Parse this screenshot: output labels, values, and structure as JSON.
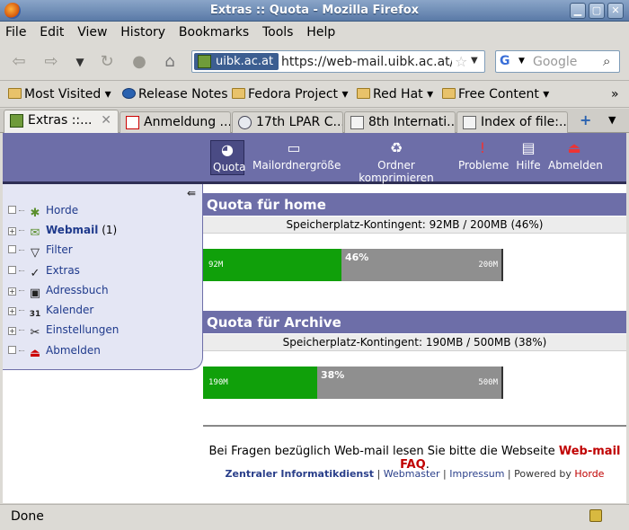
{
  "window": {
    "title": "Extras :: Quota - Mozilla Firefox"
  },
  "menu": [
    "File",
    "Edit",
    "View",
    "History",
    "Bookmarks",
    "Tools",
    "Help"
  ],
  "url": {
    "site": "uibk.ac.at",
    "address": "https://web-mail.uibk.ac.at/in"
  },
  "search": {
    "placeholder": "Google",
    "engine": "G"
  },
  "bookmarks": [
    "Most Visited",
    "Release Notes",
    "Fedora Project",
    "Red Hat",
    "Free Content"
  ],
  "tabs": [
    "Extras ::...",
    "Anmeldung ...",
    "17th LPAR C...",
    "8th Internati...",
    "Index of file:..."
  ],
  "horde_toolbar": [
    "Quota",
    "Mailordnergröße",
    "Ordner komprimieren",
    "Probleme",
    "Hilfe",
    "Abmelden"
  ],
  "sidebar": [
    {
      "label": "Horde",
      "expander": ""
    },
    {
      "label": "Webmail",
      "suffix": " (1)",
      "expander": "+"
    },
    {
      "label": "Filter",
      "expander": ""
    },
    {
      "label": "Extras",
      "expander": ""
    },
    {
      "label": "Adressbuch",
      "expander": "+"
    },
    {
      "label": "Kalender",
      "expander": "+"
    },
    {
      "label": "Einstellungen",
      "expander": "+"
    },
    {
      "label": "Abmelden",
      "expander": ""
    }
  ],
  "quotas": [
    {
      "title": "Quota für home",
      "summary": "Speicherplatz-Kontingent: 92MB / 200MB (46%)",
      "used_label": "92M",
      "max_label": "200M",
      "percent_label": "46%",
      "fraction": 0.46
    },
    {
      "title": "Quota für Archive",
      "summary": "Speicherplatz-Kontingent: 190MB / 500MB (38%)",
      "used_label": "190M",
      "max_label": "500M",
      "percent_label": "38%",
      "fraction": 0.38
    }
  ],
  "footer": {
    "question": "Bei Fragen bezüglich Web-mail lesen Sie bitte die Webseite ",
    "faq": "Web-mail FAQ",
    "dot": ".",
    "links": [
      "Zentraler Informatikdienst",
      "Webmaster",
      "Impressum"
    ],
    "sep": " | ",
    "powered": " | Powered by ",
    "horde": "Horde"
  },
  "status": {
    "text": "Done"
  },
  "colors": {
    "horde_bar": "#6d6ea8",
    "quota_used": "#10a00a",
    "quota_free": "#8f8f8f",
    "faq": "#c00000"
  }
}
